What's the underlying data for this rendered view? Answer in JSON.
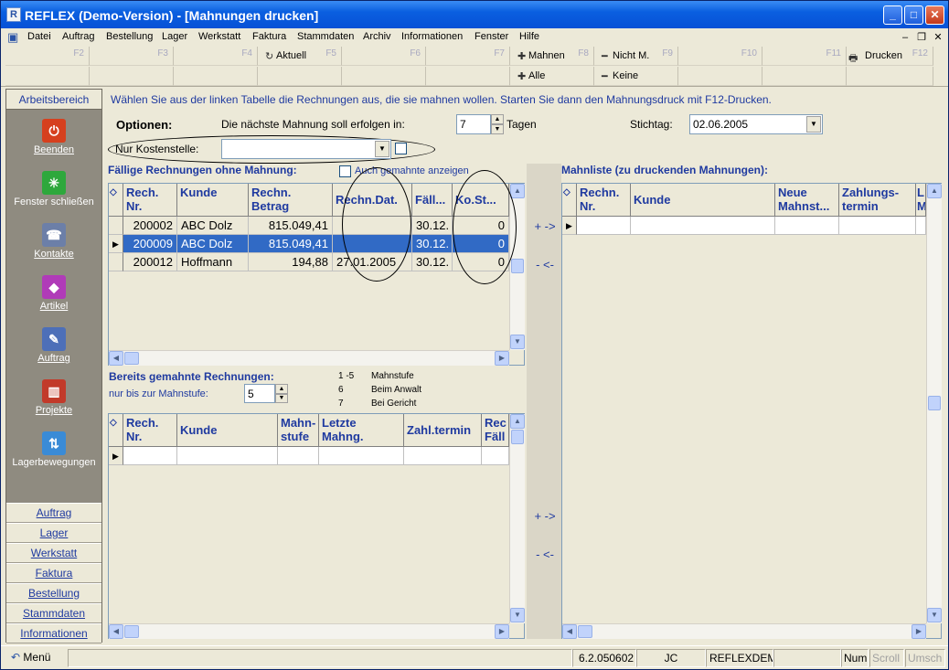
{
  "window": {
    "title": "REFLEX (Demo-Version) - [Mahnungen drucken]"
  },
  "menu": [
    "Datei",
    "Auftrag",
    "Bestellung",
    "Lager",
    "Werkstatt",
    "Faktura",
    "Stammdaten",
    "Archiv",
    "Informationen",
    "Fenster",
    "Hilfe"
  ],
  "fkeys": {
    "f2": "F2",
    "f3": "F3",
    "f4": "F4",
    "f5": "F5",
    "f6": "F6",
    "f7": "F7",
    "f8": "F8",
    "f9": "F9",
    "f10": "F10",
    "f11": "F11",
    "f12": "F12",
    "aktuell": "Aktuell",
    "mahnen": "Mahnen",
    "alle": "Alle",
    "nicht_m": "Nicht M.",
    "keine": "Keine",
    "drucken": "Drucken"
  },
  "sidebar": {
    "header": "Arbeitsbereich",
    "items": [
      "Beenden",
      "Fenster schließen",
      "Kontakte",
      "Artikel",
      "Auftrag",
      "Projekte",
      "Lagerbewegungen"
    ],
    "buttons": [
      "Auftrag",
      "Lager",
      "Werkstatt",
      "Faktura",
      "Bestellung",
      "Stammdaten",
      "Informationen"
    ]
  },
  "main": {
    "instruction": "Wählen Sie aus der linken Tabelle die Rechnungen aus, die sie mahnen wollen. Starten Sie dann den Mahnungsdruck mit F12-Drucken.",
    "optionen": "Optionen:",
    "next_mahnung_label": "Die nächste Mahnung soll erfolgen in:",
    "next_mahnung_value": "7",
    "tagen": "Tagen",
    "stichtag_label": "Stichtag:",
    "stichtag_value": "02.06.2005",
    "kostenstelle_label": "Nur Kostenstelle:",
    "kostenstelle_value": "",
    "faellige_title": "Fällige Rechnungen ohne Mahnung:",
    "auch_gemahnte": "Auch gemahnte anzeigen",
    "mahnliste_title": "Mahnliste (zu druckenden Mahnungen):",
    "bereits_title": "Bereits gemahnte Rechnungen:",
    "nur_bis_label": "nur bis zur Mahnstufe:",
    "nur_bis_value": "5",
    "legend": [
      {
        "k": "1 -5",
        "v": "Mahnstufe"
      },
      {
        "k": "6",
        "v": "Beim Anwalt"
      },
      {
        "k": "7",
        "v": "Bei Gericht"
      }
    ]
  },
  "table_faellig": {
    "headers": [
      "Rech. Nr.",
      "Kunde",
      "Rechn. Betrag",
      "Rechn.Dat.",
      "Fäll...",
      "Ko.St..."
    ],
    "rows": [
      [
        "200002",
        "ABC Dolz",
        "815.049,41",
        "",
        "30.12.",
        "0"
      ],
      [
        "200009",
        "ABC Dolz",
        "815.049,41",
        "",
        "30.12.",
        "0"
      ],
      [
        "200012",
        "Hoffmann",
        "194,88",
        "27.01.2005",
        "30.12.",
        "0"
      ]
    ]
  },
  "table_mahnliste": {
    "headers": [
      "Rechn. Nr.",
      "Kunde",
      "Neue Mahnst...",
      "Zahlungs- termin",
      "L M"
    ]
  },
  "table_gemahnt": {
    "headers": [
      "Rech. Nr.",
      "Kunde",
      "Mahn- stufe",
      "Letzte Mahng.",
      "Zahl.termin",
      "Rec Fäll"
    ]
  },
  "move": {
    "add": "+ ->",
    "remove": "- <-"
  },
  "status": {
    "menu": "Menü",
    "version": "6.2.050602",
    "user": "JC",
    "db": "REFLEXDEMO",
    "num": "Num",
    "scroll": "Scroll",
    "umsch": "Umsch"
  }
}
